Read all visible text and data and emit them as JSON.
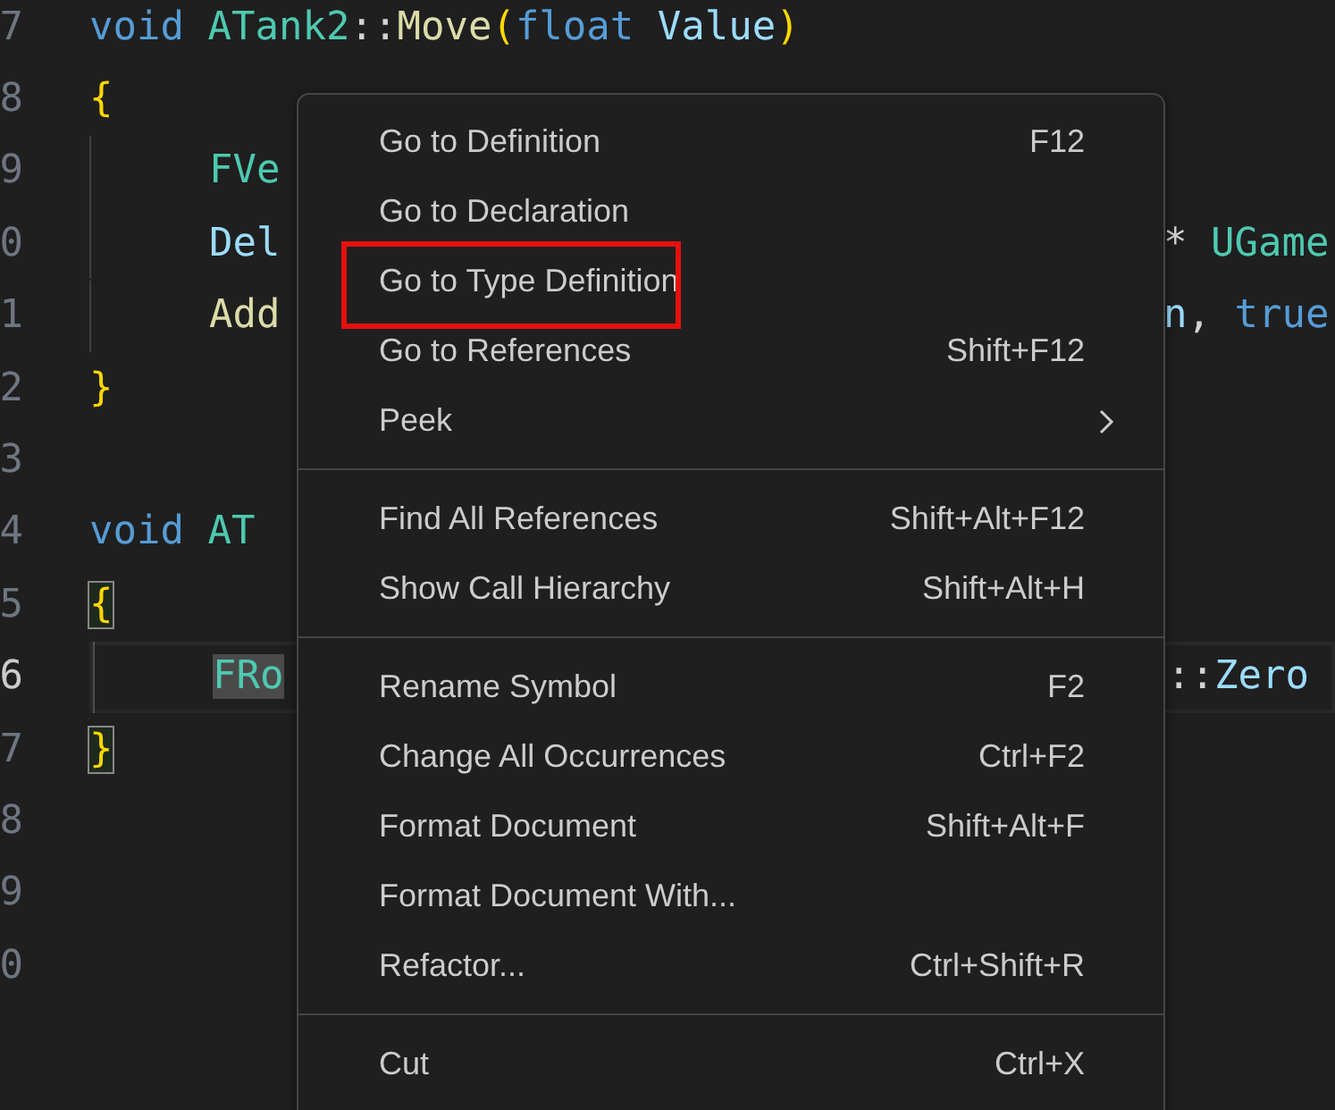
{
  "editor": {
    "lines": [
      {
        "number": "7",
        "current": false,
        "indented": false,
        "tokens": [
          {
            "text": "void",
            "kind": "keyword"
          },
          {
            "text": "ATank2",
            "kind": "type",
            "space_before": true
          },
          {
            "text": "::",
            "kind": "punct"
          },
          {
            "text": "Move",
            "kind": "func"
          },
          {
            "text": "(",
            "kind": "bracket"
          },
          {
            "text": "float",
            "kind": "keyword"
          },
          {
            "text": "Value",
            "kind": "var",
            "space_before": true
          },
          {
            "text": ")",
            "kind": "bracket"
          }
        ]
      },
      {
        "number": "8",
        "current": false,
        "indented": false,
        "tokens": [
          {
            "text": "{",
            "kind": "bracket"
          }
        ]
      },
      {
        "number": "9",
        "current": false,
        "indented": true,
        "tokens": [
          {
            "text": "FVe",
            "kind": "type"
          }
        ]
      },
      {
        "number": "0",
        "current": false,
        "indented": true,
        "tokens": [
          {
            "text": "Del",
            "kind": "var"
          }
        ],
        "tail": [
          {
            "text": "*",
            "kind": "punct"
          },
          {
            "text": "UGame",
            "kind": "type",
            "space_before": true
          }
        ]
      },
      {
        "number": "1",
        "current": false,
        "indented": true,
        "tokens": [
          {
            "text": "Add",
            "kind": "func"
          }
        ],
        "tail": [
          {
            "text": "n",
            "kind": "var"
          },
          {
            "text": ",",
            "kind": "punct"
          },
          {
            "text": "true",
            "kind": "keyword",
            "space_before": true
          }
        ]
      },
      {
        "number": "2",
        "current": false,
        "indented": false,
        "tokens": [
          {
            "text": "}",
            "kind": "bracket"
          }
        ]
      },
      {
        "number": "3",
        "current": false,
        "indented": false
      },
      {
        "number": "4",
        "current": false,
        "indented": false,
        "tokens": [
          {
            "text": "void",
            "kind": "keyword"
          },
          {
            "text": "AT",
            "kind": "type",
            "space_before": true
          }
        ]
      },
      {
        "number": "5",
        "current": false,
        "indented": false,
        "tokens": [
          {
            "text": "{",
            "kind": "bracket",
            "matched": true
          }
        ]
      },
      {
        "number": "6",
        "current": true,
        "indented": true,
        "tokens": [
          {
            "text": "FRo",
            "kind": "type",
            "highlight": true
          }
        ],
        "tail": [
          {
            "text": "::",
            "kind": "punct"
          },
          {
            "text": "Zero",
            "kind": "var"
          }
        ]
      },
      {
        "number": "7",
        "current": false,
        "indented": false,
        "tokens": [
          {
            "text": "}",
            "kind": "bracket",
            "matched": true
          }
        ]
      },
      {
        "number": "8",
        "current": false,
        "indented": false
      },
      {
        "number": "9",
        "current": false,
        "indented": false
      },
      {
        "number": "0",
        "current": false,
        "indented": false
      }
    ]
  },
  "context_menu": {
    "groups": [
      {
        "items": [
          {
            "label": "Go to Definition",
            "shortcut": "F12",
            "submenu": false,
            "annotated": false
          },
          {
            "label": "Go to Declaration",
            "submenu": false,
            "annotated": false
          },
          {
            "label": "Go to Type Definition",
            "submenu": false,
            "annotated": true
          },
          {
            "label": "Go to References",
            "shortcut": "Shift+F12",
            "submenu": false,
            "annotated": false
          },
          {
            "label": "Peek",
            "submenu": true,
            "annotated": false
          }
        ]
      },
      {
        "items": [
          {
            "label": "Find All References",
            "shortcut": "Shift+Alt+F12",
            "submenu": false,
            "annotated": false
          },
          {
            "label": "Show Call Hierarchy",
            "shortcut": "Shift+Alt+H",
            "submenu": false,
            "annotated": false
          }
        ]
      },
      {
        "items": [
          {
            "label": "Rename Symbol",
            "shortcut": "F2",
            "submenu": false,
            "annotated": false
          },
          {
            "label": "Change All Occurrences",
            "shortcut": "Ctrl+F2",
            "submenu": false,
            "annotated": false
          },
          {
            "label": "Format Document",
            "shortcut": "Shift+Alt+F",
            "submenu": false,
            "annotated": false
          },
          {
            "label": "Format Document With...",
            "submenu": false,
            "annotated": false
          },
          {
            "label": "Refactor...",
            "shortcut": "Ctrl+Shift+R",
            "submenu": false,
            "annotated": false
          }
        ]
      },
      {
        "items": [
          {
            "label": "Cut",
            "shortcut": "Ctrl+X",
            "submenu": false,
            "annotated": false
          }
        ]
      }
    ]
  }
}
